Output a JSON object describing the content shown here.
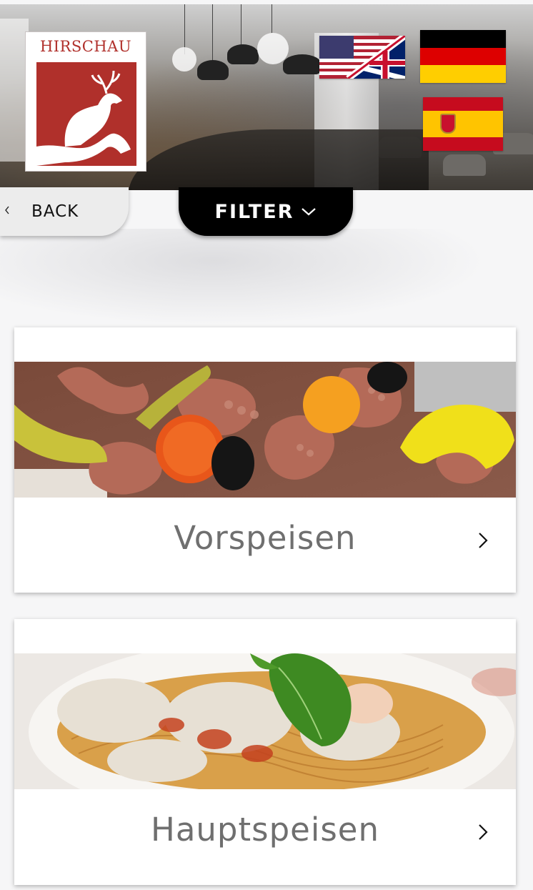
{
  "header": {
    "logo_text": "HIRSCHAU",
    "languages": [
      {
        "name": "english",
        "icon": "us-uk-flag-icon"
      },
      {
        "name": "german",
        "icon": "german-flag-icon"
      },
      {
        "name": "spanish",
        "icon": "spanish-flag-icon"
      }
    ]
  },
  "nav": {
    "back_label": "BACK",
    "back_icon": "chevron-left-icon",
    "filter_label": "FILTER",
    "filter_icon": "chevron-down-icon"
  },
  "categories": [
    {
      "title": "Vorspeisen",
      "icon": "chevron-right-icon"
    },
    {
      "title": "Hauptspeisen",
      "icon": "chevron-right-icon"
    }
  ],
  "colors": {
    "brand_red": "#b0302b",
    "filter_bg": "#000000",
    "title_gray": "#6f6f6f"
  }
}
